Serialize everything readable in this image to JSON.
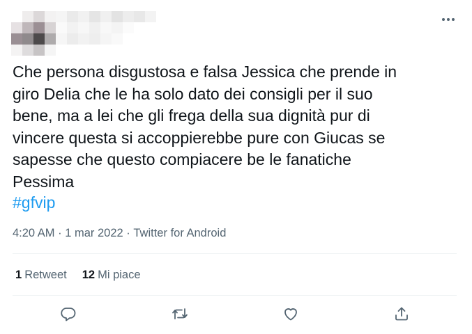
{
  "tweet": {
    "text_lines": [
      "Che persona disgustosa e falsa Jessica che prende in",
      "giro Delia che le ha solo dato dei consigli per il suo",
      "bene, ma a lei che gli frega della sua dignità pur di",
      "vincere questa si accoppierebbe pure con Giucas se",
      "sapesse che questo compiacere be le fanatiche",
      "Pessima"
    ],
    "hashtag": "#gfvip",
    "time": "4:20 AM",
    "separator": "·",
    "date": "1 mar 2022",
    "source": "Twitter for Android"
  },
  "stats": {
    "retweets_count": "1",
    "retweets_label": "Retweet",
    "likes_count": "12",
    "likes_label": "Mi piace"
  },
  "icons": {
    "more": "more-horizontal-icon",
    "reply": "reply-icon",
    "retweet": "retweet-icon",
    "like": "heart-icon",
    "share": "share-icon"
  },
  "colors": {
    "text": "#0f1419",
    "secondary": "#536471",
    "link": "#1d9bf0",
    "divider": "#eff3f4"
  }
}
